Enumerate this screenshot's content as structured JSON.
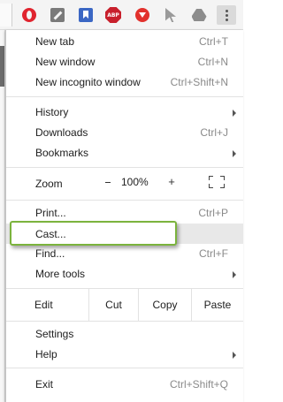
{
  "toolbar": {
    "extensions": [
      "opera-icon",
      "wrench-icon",
      "bookmark-icon",
      "adblock-plus-icon",
      "download-icon",
      "cursor-icon",
      "drive-icon"
    ],
    "abp_text": "ABP",
    "menu_button": "more-vert-icon"
  },
  "menu": {
    "new_tab": {
      "label": "New tab",
      "shortcut": "Ctrl+T"
    },
    "new_window": {
      "label": "New window",
      "shortcut": "Ctrl+N"
    },
    "new_incognito": {
      "label": "New incognito window",
      "shortcut": "Ctrl+Shift+N"
    },
    "history": {
      "label": "History"
    },
    "downloads": {
      "label": "Downloads",
      "shortcut": "Ctrl+J"
    },
    "bookmarks": {
      "label": "Bookmarks"
    },
    "zoom": {
      "label": "Zoom",
      "minus": "–",
      "value": "100%",
      "plus": "+"
    },
    "print": {
      "label": "Print...",
      "shortcut": "Ctrl+P"
    },
    "cast": {
      "label": "Cast..."
    },
    "find": {
      "label": "Find...",
      "shortcut": "Ctrl+F"
    },
    "more_tools": {
      "label": "More tools"
    },
    "edit": {
      "label": "Edit",
      "cut": "Cut",
      "copy": "Copy",
      "paste": "Paste"
    },
    "settings": {
      "label": "Settings"
    },
    "help": {
      "label": "Help"
    },
    "exit": {
      "label": "Exit",
      "shortcut": "Ctrl+Shift+Q"
    }
  },
  "colors": {
    "highlight_border": "#7bb33d",
    "hover_bg": "#e8e8e8"
  }
}
